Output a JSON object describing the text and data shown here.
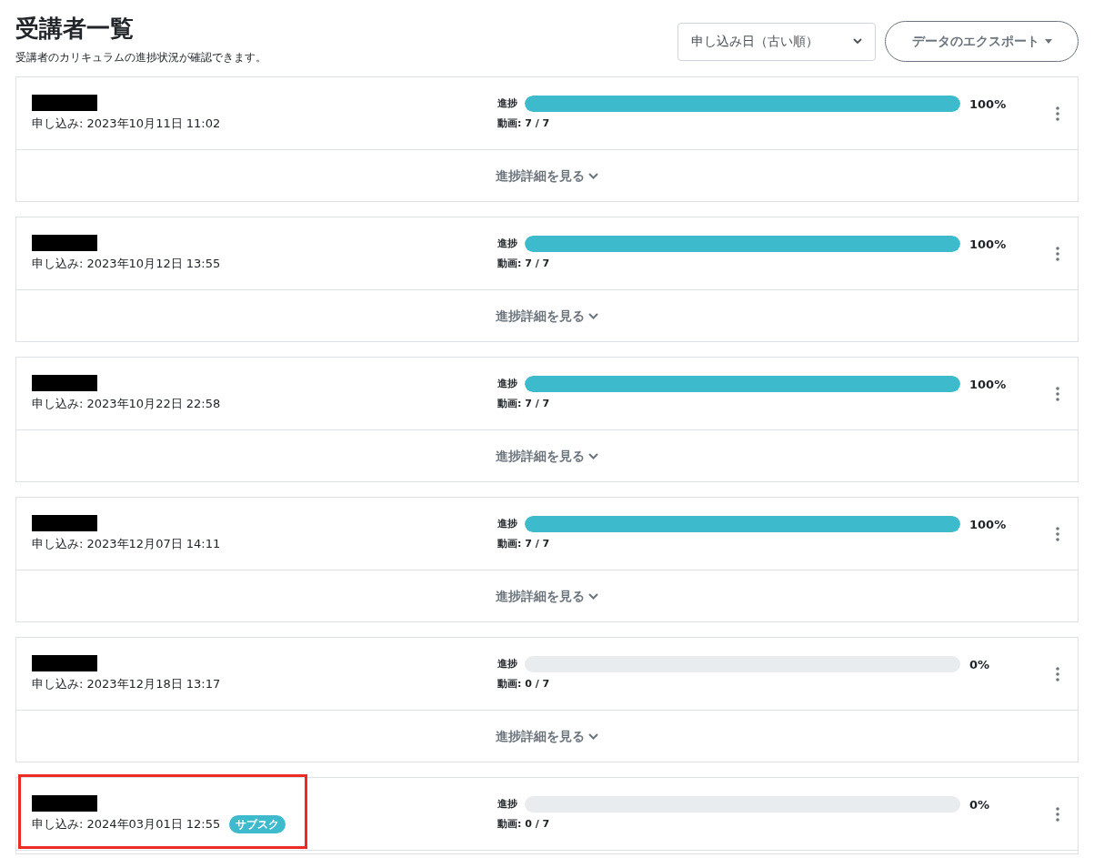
{
  "header": {
    "title": "受講者一覧",
    "subtitle": "受講者のカリキュラムの進捗状況が確認できます。",
    "sort_select": {
      "value": "申し込み日（古い順）"
    },
    "export_button": {
      "label": "データのエクスポート"
    }
  },
  "students": [
    {
      "applied": "申し込み: 2023年10月11日 11:02",
      "progress_label": "進捗",
      "level": 1,
      "percent": "100%",
      "videos": "動画: 7 / 7",
      "details_toggle": "進捗詳細を見る",
      "highlighted": false
    },
    {
      "applied": "申し込み: 2023年10月12日 13:55",
      "progress_label": "進捗",
      "level": 1,
      "percent": "100%",
      "videos": "動画: 7 / 7",
      "details_toggle": "進捗詳細を見る",
      "highlighted": false
    },
    {
      "applied": "申し込み: 2023年10月22日 22:58",
      "progress_label": "進捗",
      "level": 1,
      "percent": "100%",
      "videos": "動画: 7 / 7",
      "details_toggle": "進捗詳細を見る",
      "highlighted": false
    },
    {
      "applied": "申し込み: 2023年12月07日 14:11",
      "progress_label": "進捗",
      "level": 1,
      "percent": "100%",
      "videos": "動画: 7 / 7",
      "details_toggle": "進捗詳細を見る",
      "highlighted": false
    },
    {
      "applied": "申し込み: 2023年12月18日 13:17",
      "progress_label": "進捗",
      "level": 0,
      "percent": "0%",
      "videos": "動画: 0 / 7",
      "details_toggle": "進捗詳細を見る",
      "highlighted": false
    },
    {
      "applied": "申し込み: 2024年03月01日 12:55",
      "badge": "サブスク",
      "progress_label": "進捗",
      "level": 0,
      "percent": "0%",
      "videos": "動画: 0 / 7",
      "highlighted": true
    }
  ]
}
